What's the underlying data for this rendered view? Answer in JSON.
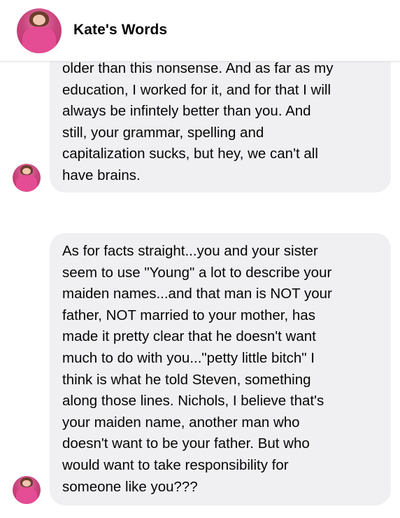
{
  "header": {
    "title": "Kate's Words",
    "avatar_icon": "profile-photo-icon"
  },
  "messages": [
    {
      "text": "older than this nonsense. And as far as my\neducation, I worked for it, and for that I will\nalways be infintely better than you. And\nstill, your grammar, spelling and\ncapitalization sucks, but hey, we can't all\nhave brains."
    },
    {
      "text": "As for facts straight...you and your sister\nseem to use \"Young\" a lot to describe your\nmaiden names...and that man is NOT your\nfather, NOT married to your mother, has\nmade it pretty clear that he doesn't want\nmuch to do with you...\"petty little bitch\" I\nthink is what he told Steven, something\nalong those lines. Nichols, I believe that's\nyour maiden name, another man who\ndoesn't want to be your father. But who\nwould want to take responsibility for\nsomeone like you???"
    }
  ],
  "colors": {
    "bubble_background": "#f0f0f2",
    "text": "#050505",
    "avatar_accent": "#e44c93"
  }
}
